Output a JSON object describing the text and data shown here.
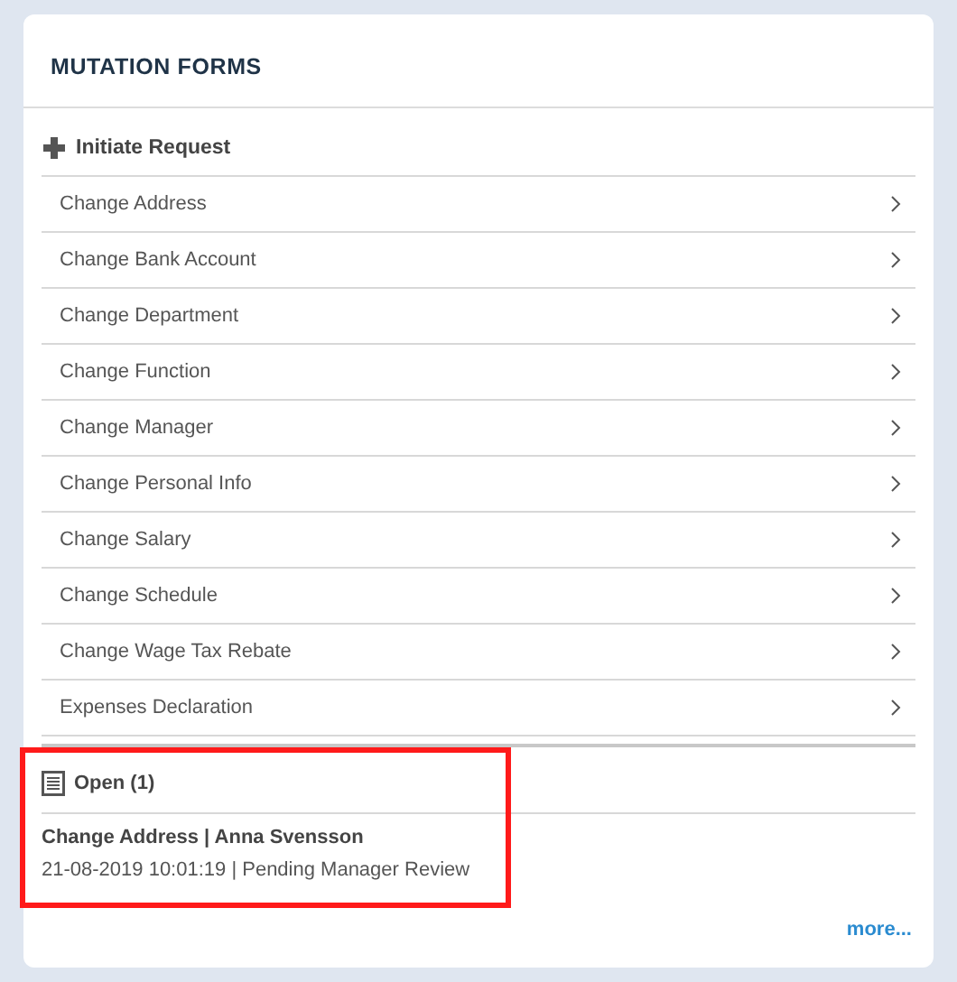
{
  "card": {
    "title": "MUTATION FORMS"
  },
  "initiate": {
    "label": "Initiate Request"
  },
  "forms": [
    {
      "label": "Change Address"
    },
    {
      "label": "Change Bank Account"
    },
    {
      "label": "Change Department"
    },
    {
      "label": "Change Function"
    },
    {
      "label": "Change Manager"
    },
    {
      "label": "Change Personal Info"
    },
    {
      "label": "Change Salary"
    },
    {
      "label": "Change Schedule"
    },
    {
      "label": "Change Wage Tax Rebate"
    },
    {
      "label": "Expenses Declaration"
    }
  ],
  "open": {
    "title": "Open (1)",
    "highlighted": true,
    "items": [
      {
        "title": "Change Address | Anna Svensson",
        "detail": "21-08-2019 10:01:19 | Pending Manager Review"
      }
    ]
  },
  "more": {
    "label": "more..."
  }
}
